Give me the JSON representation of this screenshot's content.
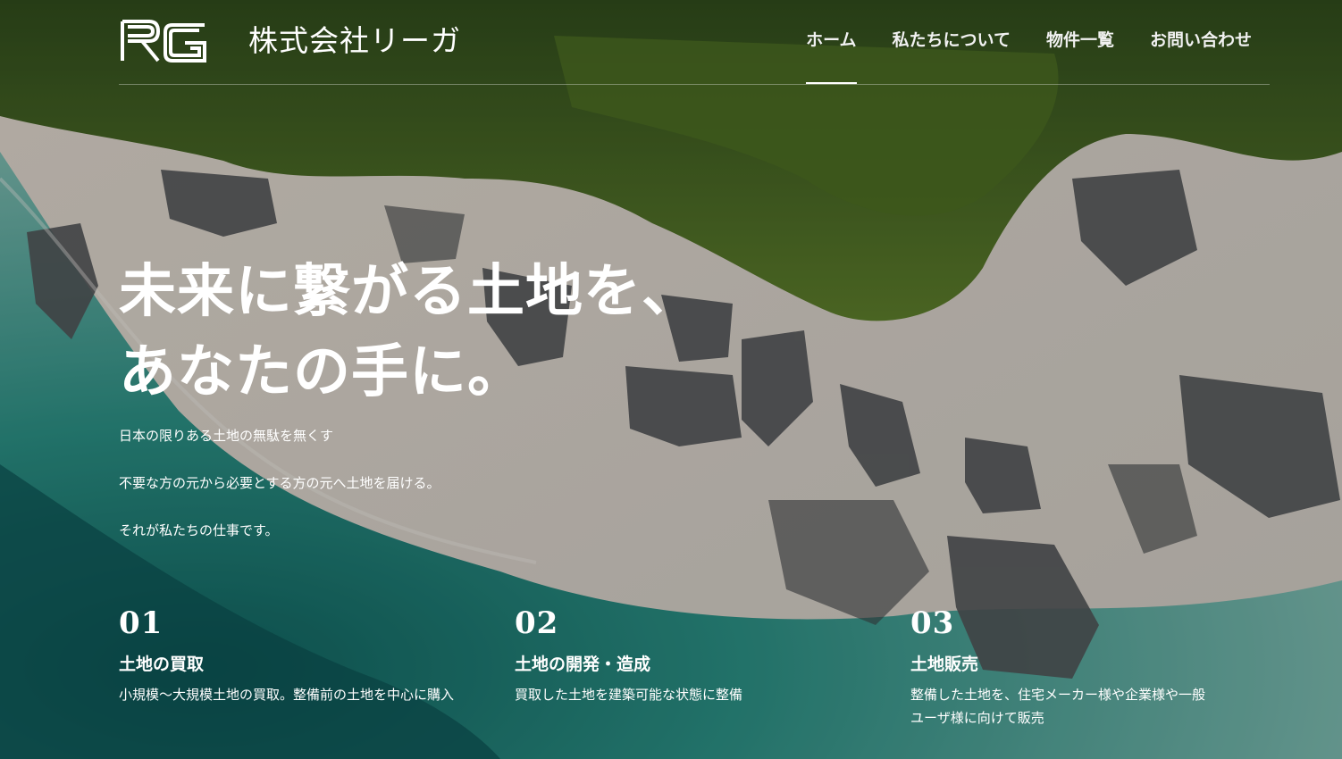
{
  "header": {
    "logo_text": "RG",
    "company_name": "株式会社リーガ",
    "nav": [
      {
        "label": "ホーム",
        "active": true
      },
      {
        "label": "私たちについて",
        "active": false
      },
      {
        "label": "物件一覧",
        "active": false
      },
      {
        "label": "お問い合わせ",
        "active": false
      }
    ]
  },
  "hero": {
    "headline_lines": [
      "未来に繋がる土地を、",
      "あなたの手に。"
    ],
    "lead_lines": [
      "日本の限りある土地の無駄を無くす",
      "不要な方の元から必要とする方の元へ土地を届ける。",
      "それが私たちの仕事です。"
    ]
  },
  "features": [
    {
      "num": "01",
      "title": "土地の買取",
      "desc": "小規模〜大規模土地の買取。整備前の土地を中心に購入"
    },
    {
      "num": "02",
      "title": "土地の開発・造成",
      "desc": "買取した土地を建築可能な状態に整備"
    },
    {
      "num": "03",
      "title": "土地販売",
      "desc": "整備した土地を、住宅メーカー様や企業様や一般ユーザ様に向けて販売"
    }
  ],
  "colors": {
    "text": "#ffffff",
    "forest": "#3f5a24",
    "sand": "#d9d2c9",
    "sea": "#1f7a72",
    "rock": "#4e5053"
  }
}
